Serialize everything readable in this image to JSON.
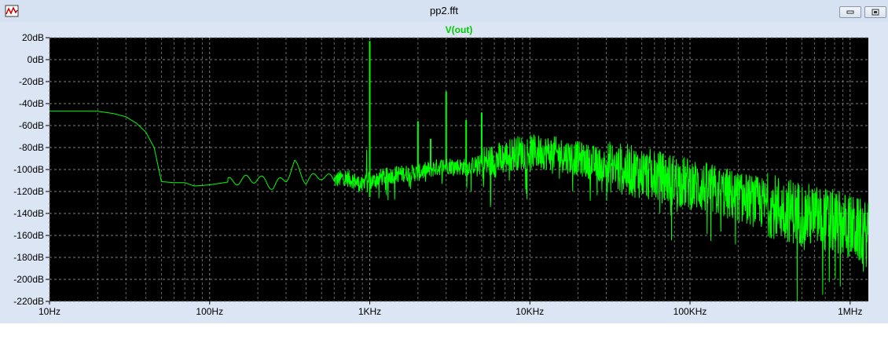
{
  "window": {
    "title": "pp2.fft",
    "app_icon": "waveform-icon",
    "controls": [
      "minimize-icon",
      "restore-icon"
    ]
  },
  "colors": {
    "plot_bg": "#000000",
    "trace": "#00ff00",
    "grid": "#808080",
    "axis_text": "#000000",
    "frame_bg": "#dbe5f3"
  },
  "chart_data": {
    "type": "line",
    "title": "",
    "xscale": "log",
    "grid": true,
    "xlim": [
      10,
      1300000
    ],
    "ylim": [
      -220,
      20
    ],
    "x_ticks": [
      10,
      100,
      1000,
      10000,
      100000,
      1000000
    ],
    "x_tick_labels": [
      "10Hz",
      "100Hz",
      "1KHz",
      "10KHz",
      "100KHz",
      "1MHz"
    ],
    "y_ticks": [
      20,
      0,
      -20,
      -40,
      -60,
      -80,
      -100,
      -120,
      -140,
      -160,
      -180,
      -200,
      -220
    ],
    "y_tick_labels": [
      "20dB",
      "0dB",
      "-20dB",
      "-40dB",
      "-60dB",
      "-80dB",
      "-100dB",
      "-120dB",
      "-140dB",
      "-160dB",
      "-180dB",
      "-200dB",
      "-220dB"
    ],
    "series": [
      {
        "name": "V(out)",
        "color": "#00ff00",
        "x": [
          10,
          20,
          25,
          30,
          35,
          40,
          45,
          50,
          60,
          70,
          80,
          100,
          150,
          200,
          250,
          300,
          340,
          400,
          500,
          600,
          700,
          800,
          900,
          950,
          1000,
          1050,
          1100,
          1300,
          1500,
          2000,
          2500,
          3000,
          4000,
          5000,
          6000,
          7000,
          8000,
          10000,
          12000,
          15000,
          20000,
          30000,
          50000,
          100000,
          200000,
          500000,
          1000000,
          1300000
        ],
        "y": [
          -47,
          -47,
          -49,
          -52,
          -58,
          -66,
          -80,
          -111,
          -112,
          -112,
          -115,
          -114,
          -110,
          -108,
          -115,
          -108,
          -95,
          -110,
          -105,
          -110,
          -107,
          -110,
          -115,
          -105,
          17,
          -112,
          -108,
          -106,
          -104,
          -103,
          -99,
          -96,
          -98,
          -94,
          -92,
          -89,
          -85,
          -84,
          -84,
          -86,
          -90,
          -97,
          -103,
          -113,
          -125,
          -140,
          -152,
          -160
        ]
      }
    ],
    "spikes": [
      {
        "x": 1000,
        "y": 17
      },
      {
        "x": 2000,
        "y": -56
      },
      {
        "x": 2400,
        "y": -72
      },
      {
        "x": 3000,
        "y": -29
      },
      {
        "x": 4000,
        "y": -55
      },
      {
        "x": 5000,
        "y": -48
      }
    ]
  }
}
